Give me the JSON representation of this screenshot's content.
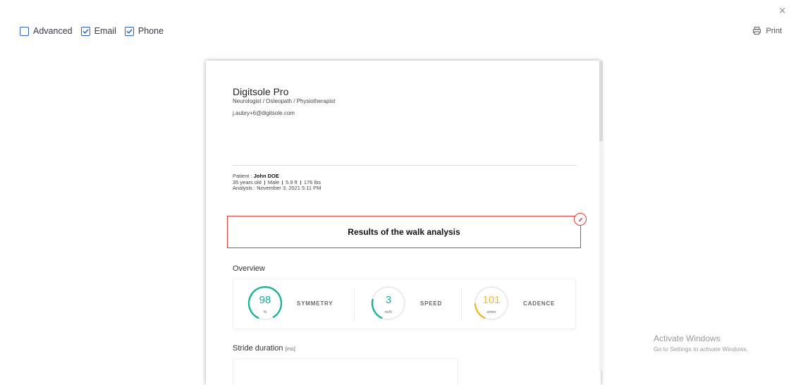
{
  "toolbar": {
    "options": [
      {
        "label": "Advanced",
        "checked": false
      },
      {
        "label": "Email",
        "checked": true
      },
      {
        "label": "Phone",
        "checked": true
      }
    ],
    "print_label": "Print",
    "close_glyph": "×"
  },
  "document": {
    "practitioner": {
      "name": "Digitsole Pro",
      "role": "Neurologist / Osteopath / Physiotherapist",
      "email": "j.aubry+6@digitsole.com"
    },
    "patient": {
      "label": "Patient : ",
      "name": "John DOE",
      "age": "35 years old",
      "sex": "Male",
      "height": "5.9 ft",
      "weight": "176 lbs",
      "analysis": "Analysis : November 3, 2021 5:11 PM"
    },
    "results_title": "Results of the walk analysis",
    "overview_title": "Overview",
    "metrics": [
      {
        "value": "98",
        "unit": "%",
        "label": "SYMMETRY",
        "color": "#19b394",
        "fraction": 0.98
      },
      {
        "value": "3",
        "unit": "mi/h",
        "label": "SPEED",
        "color": "#19b394",
        "fraction": 0.25
      },
      {
        "value": "101",
        "unit": "s/min",
        "label": "CADENCE",
        "color": "#f5b82e",
        "fraction": 0.2
      }
    ],
    "stride_title": "Stride duration",
    "stride_unit": "[ms]"
  },
  "watermark": {
    "line1": "Activate Windows",
    "line2": "Go to Settings to activate Windows."
  },
  "colors": {
    "accent_blue": "#2b63c9",
    "highlight_red": "#e03b3b",
    "green": "#19b394",
    "yellow": "#f5b82e"
  }
}
